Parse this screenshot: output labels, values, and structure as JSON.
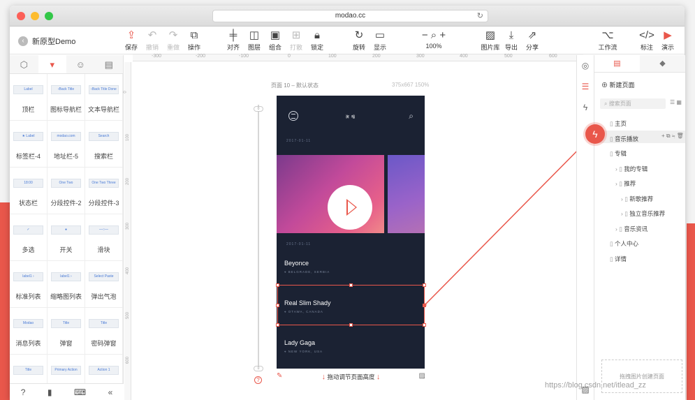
{
  "browser": {
    "url": "modao.cc"
  },
  "project": {
    "name": "新原型Demo"
  },
  "toolbar": {
    "save": "保存",
    "undo": "撤销",
    "redo": "重做",
    "operate": "操作",
    "align": "对齐",
    "layer": "图层",
    "group": "组合",
    "ungroup": "打散",
    "lock": "锁定",
    "rotate": "旋转",
    "display": "显示",
    "zoom": "100%",
    "library": "图片库",
    "export": "导出",
    "share": "分享",
    "workflow": "工作流",
    "annotate": "标注",
    "demo": "演示"
  },
  "ruler": {
    "ticks": [
      "-300",
      "-200",
      "-100",
      "0",
      "100",
      "200",
      "300",
      "400",
      "500",
      "600"
    ]
  },
  "vruler": {
    "ticks": [
      "0",
      "100",
      "200",
      "300",
      "400",
      "500",
      "600"
    ]
  },
  "left_panel": {
    "widgets": [
      {
        "label": "顶栏",
        "preview": "Label"
      },
      {
        "label": "图标导航栏",
        "preview": "‹Back Title"
      },
      {
        "label": "文本导航栏",
        "preview": "‹Back Title Done"
      },
      {
        "label": "标签栏-4",
        "preview": "★ Label"
      },
      {
        "label": "地址栏-5",
        "preview": "modao.com"
      },
      {
        "label": "搜索栏",
        "preview": "Search"
      },
      {
        "label": "状态栏",
        "preview": "18:00"
      },
      {
        "label": "分段控件-2",
        "preview": "One Two"
      },
      {
        "label": "分段控件-3",
        "preview": "One Two Three"
      },
      {
        "label": "多选",
        "preview": "✓"
      },
      {
        "label": "开关",
        "preview": "●"
      },
      {
        "label": "滑块",
        "preview": "—○—"
      },
      {
        "label": "标准列表",
        "preview": "label1 ›"
      },
      {
        "label": "缩略图列表",
        "preview": "label1 ›"
      },
      {
        "label": "弹出气泡",
        "preview": "Select Paste"
      },
      {
        "label": "消息列表",
        "preview": "Modao"
      },
      {
        "label": "弹窗",
        "preview": "Title"
      },
      {
        "label": "密码弹窗",
        "preview": "Title"
      },
      {
        "label": "",
        "preview": "Title"
      },
      {
        "label": "",
        "preview": "Primary Action"
      },
      {
        "label": "",
        "preview": "Action 1"
      }
    ]
  },
  "canvas": {
    "page_caption": "页面 10 – 默认状态",
    "page_size": "375x667 150%",
    "bottom_hint": "拖动调节页面高度",
    "slider_top": "0",
    "slider_bottom": "0"
  },
  "phone": {
    "title": "演 唱",
    "date1": "2017-01-11",
    "date2": "2017-01-11",
    "songs": [
      {
        "name": "Beyonce",
        "location": "BELGRADE, SERBIA"
      },
      {
        "name": "Real Slim Shady",
        "location": "OTAWA, CANADA"
      },
      {
        "name": "Lady Gaga",
        "location": "NEW YORK, USA"
      }
    ]
  },
  "right_panel": {
    "new_page": "新建页面",
    "search_placeholder": "搜索页面",
    "tree": [
      {
        "label": "主页",
        "indent": 0
      },
      {
        "label": "音乐播放",
        "indent": 0,
        "active": true
      },
      {
        "label": "专辑",
        "indent": 0
      },
      {
        "label": "我的专辑",
        "indent": 1
      },
      {
        "label": "推荐",
        "indent": 1
      },
      {
        "label": "新歌推荐",
        "indent": 2
      },
      {
        "label": "独立音乐推荐",
        "indent": 2
      },
      {
        "label": "音乐资讯",
        "indent": 1
      },
      {
        "label": "个人中心",
        "indent": 0
      },
      {
        "label": "详情",
        "indent": 0
      }
    ],
    "dropzone": "拖拽图片创建页面"
  },
  "watermark": "https://blog.csdn.net/itlead_zz",
  "colors": {
    "accent": "#e9574b",
    "phone_bg": "#1b2233"
  }
}
